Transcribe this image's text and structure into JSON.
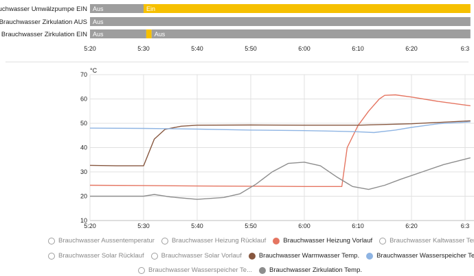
{
  "timeline": {
    "rows": [
      {
        "label": "Brauchwasser Umwälzpumpe EIN",
        "segments": [
          {
            "state": "Aus",
            "from": "5:20",
            "to": "5:30",
            "color": "#9e9e9e"
          },
          {
            "state": "Ein",
            "from": "5:30",
            "to": "6:31",
            "color": "#f6c000"
          }
        ]
      },
      {
        "label": "Brauchwasser Zirkulation AUS",
        "segments": [
          {
            "state": "Aus",
            "from": "5:20",
            "to": "6:31",
            "color": "#9e9e9e"
          }
        ]
      },
      {
        "label": "Brauchwasser Zirkulation EIN",
        "segments": [
          {
            "state": "Aus",
            "from": "5:20",
            "to": "5:30.5",
            "color": "#9e9e9e"
          },
          {
            "state": "",
            "from": "5:30.5",
            "to": "5:31.5",
            "color": "#f6c000"
          },
          {
            "state": "Aus",
            "from": "5:31.5",
            "to": "6:31",
            "color": "#9e9e9e"
          }
        ]
      }
    ],
    "ticks": [
      "5:20",
      "5:30",
      "5:40",
      "5:50",
      "6:00",
      "6:10",
      "6:20",
      "6:3"
    ]
  },
  "chart_data": {
    "type": "line",
    "ylabel": "°C",
    "ylim": [
      10,
      70
    ],
    "yticks": [
      10,
      20,
      30,
      40,
      50,
      60,
      70
    ],
    "x_unit": "time",
    "x_ticks": [
      "5:20",
      "5:30",
      "5:40",
      "5:50",
      "6:00",
      "6:10",
      "6:20",
      "6:3"
    ],
    "grid": true,
    "series": [
      {
        "name": "Brauchwasser Heizung Vorlauf",
        "color": "#e57561",
        "points": [
          [
            "5:20",
            24.5
          ],
          [
            "5:30",
            24.4
          ],
          [
            "5:40",
            24.2
          ],
          [
            "5:50",
            24.1
          ],
          [
            "6:00",
            24.0
          ],
          [
            "6:07",
            24.0
          ],
          [
            "6:08",
            40.0
          ],
          [
            "6:10",
            49.0
          ],
          [
            "6:12",
            55.0
          ],
          [
            "6:14",
            60.0
          ],
          [
            "6:15",
            61.5
          ],
          [
            "6:17",
            61.7
          ],
          [
            "6:20",
            60.8
          ],
          [
            "6:25",
            59.0
          ],
          [
            "6:31",
            57.2
          ]
        ]
      },
      {
        "name": "Brauchwasser Warmwasser Temp.",
        "color": "#86563e",
        "points": [
          [
            "5:20",
            32.7
          ],
          [
            "5:25",
            32.5
          ],
          [
            "5:30",
            32.5
          ],
          [
            "5:31",
            38.0
          ],
          [
            "5:32",
            43.5
          ],
          [
            "5:34",
            47.5
          ],
          [
            "5:37",
            48.8
          ],
          [
            "5:40",
            49.2
          ],
          [
            "5:50",
            49.3
          ],
          [
            "6:00",
            49.2
          ],
          [
            "6:10",
            49.2
          ],
          [
            "6:20",
            49.8
          ],
          [
            "6:31",
            51.0
          ]
        ]
      },
      {
        "name": "Brauchwasser Wasserspeicher Temp.",
        "color": "#8eb4e3",
        "points": [
          [
            "5:20",
            48.0
          ],
          [
            "5:30",
            47.9
          ],
          [
            "5:40",
            47.6
          ],
          [
            "5:50",
            47.2
          ],
          [
            "6:00",
            47.0
          ],
          [
            "6:05",
            46.8
          ],
          [
            "6:10",
            46.5
          ],
          [
            "6:13",
            46.2
          ],
          [
            "6:17",
            47.2
          ],
          [
            "6:20",
            48.3
          ],
          [
            "6:25",
            49.8
          ],
          [
            "6:31",
            50.6
          ]
        ]
      },
      {
        "name": "Brauchwasser Zirkulation Temp.",
        "color": "#8d8d8d",
        "points": [
          [
            "5:20",
            20.0
          ],
          [
            "5:25",
            20.0
          ],
          [
            "5:30",
            20.0
          ],
          [
            "5:32",
            20.7
          ],
          [
            "5:35",
            19.7
          ],
          [
            "5:40",
            18.7
          ],
          [
            "5:45",
            19.5
          ],
          [
            "5:48",
            21.0
          ],
          [
            "5:51",
            25.0
          ],
          [
            "5:54",
            30.0
          ],
          [
            "5:57",
            33.5
          ],
          [
            "6:00",
            34.0
          ],
          [
            "6:03",
            32.5
          ],
          [
            "6:06",
            28.0
          ],
          [
            "6:09",
            24.0
          ],
          [
            "6:12",
            22.8
          ],
          [
            "6:15",
            24.5
          ],
          [
            "6:18",
            27.0
          ],
          [
            "6:22",
            30.0
          ],
          [
            "6:26",
            33.0
          ],
          [
            "6:31",
            35.8
          ]
        ]
      }
    ]
  },
  "legend": {
    "rows": [
      [
        {
          "label": "Brauchwasser Aussentemperatur",
          "color": "",
          "visible": false
        },
        {
          "label": "Brauchwasser Heizung Rücklauf",
          "color": "",
          "visible": false
        },
        {
          "label": "Brauchwasser Heizung Vorlauf",
          "color": "#e57561",
          "visible": true
        },
        {
          "label": "Brauchwasser Kaltwasser Temp.",
          "color": "",
          "visible": false
        }
      ],
      [
        {
          "label": "Brauchwasser Solar Rücklauf",
          "color": "",
          "visible": false
        },
        {
          "label": "Brauchwasser Solar Vorlauf",
          "color": "",
          "visible": false
        },
        {
          "label": "Brauchwasser Warmwasser Temp.",
          "color": "#86563e",
          "visible": true
        },
        {
          "label": "Brauchwasser Wasserspeicher Te...",
          "color": "#8eb4e3",
          "visible": true
        }
      ],
      [
        {
          "label": "Brauchwasser Wasserspeicher Te...",
          "color": "",
          "visible": false
        },
        {
          "label": "Brauchwasser Zirkulation Temp.",
          "color": "#8d8d8d",
          "visible": true
        }
      ]
    ]
  }
}
